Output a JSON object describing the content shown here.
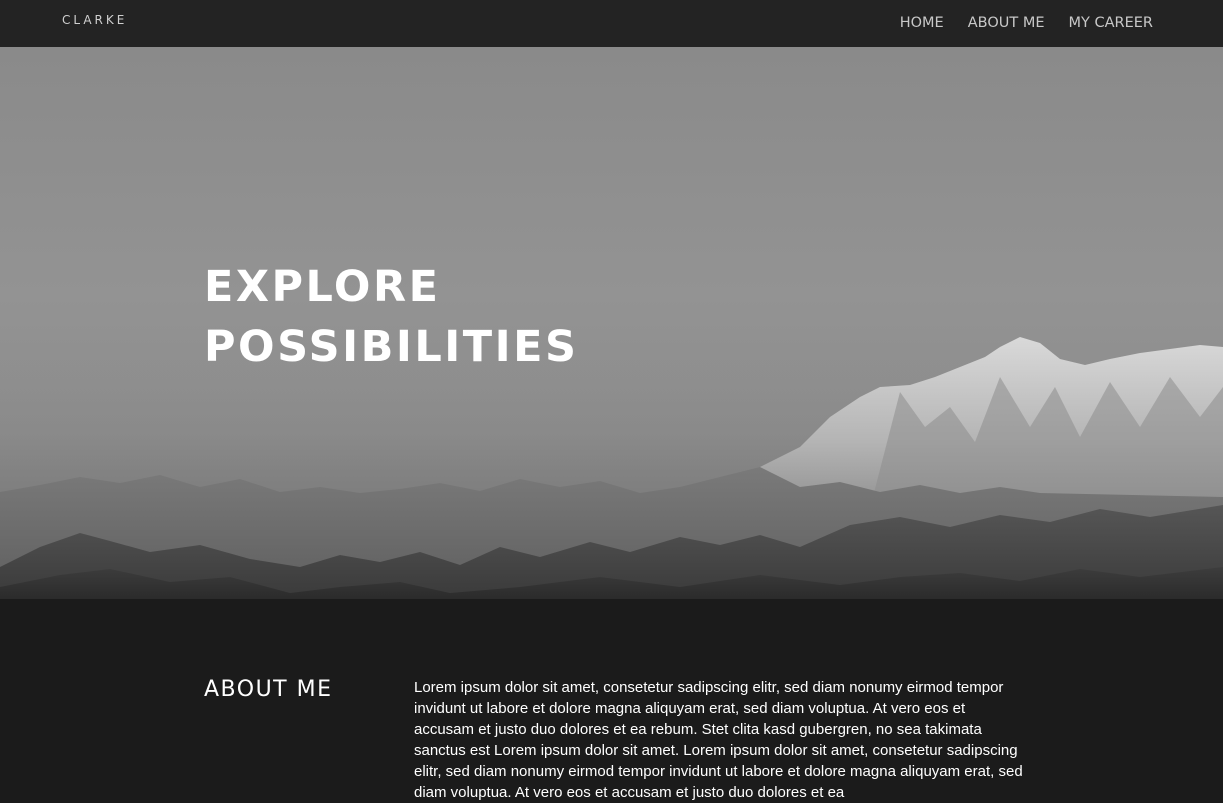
{
  "header": {
    "brand": "CLARKE",
    "nav": [
      {
        "label": "HOME"
      },
      {
        "label": "ABOUT ME"
      },
      {
        "label": "MY CAREER"
      }
    ]
  },
  "hero": {
    "title_line1": "EXPLORE",
    "title_line2": "POSSIBILITIES",
    "image": "grayscale-mountain-range-photo"
  },
  "about": {
    "heading": "ABOUT ME",
    "text": "Lorem ipsum dolor sit amet, consetetur sadipscing elitr, sed diam nonumy eirmod tempor invidunt ut labore et dolore magna aliquyam erat, sed diam voluptua. At vero eos et accusam et justo duo dolores et ea rebum. Stet clita kasd gubergren, no sea takimata sanctus est Lorem ipsum dolor sit amet. Lorem ipsum dolor sit amet, consetetur sadipscing elitr, sed diam nonumy eirmod tempor invidunt ut labore et dolore magna aliquyam erat, sed diam voluptua. At vero eos et accusam et justo duo dolores et ea"
  },
  "colors": {
    "nav_background": "#232323",
    "page_background": "#1b1b1b",
    "text_light": "#ffffff",
    "nav_text": "#c8c8c8"
  }
}
